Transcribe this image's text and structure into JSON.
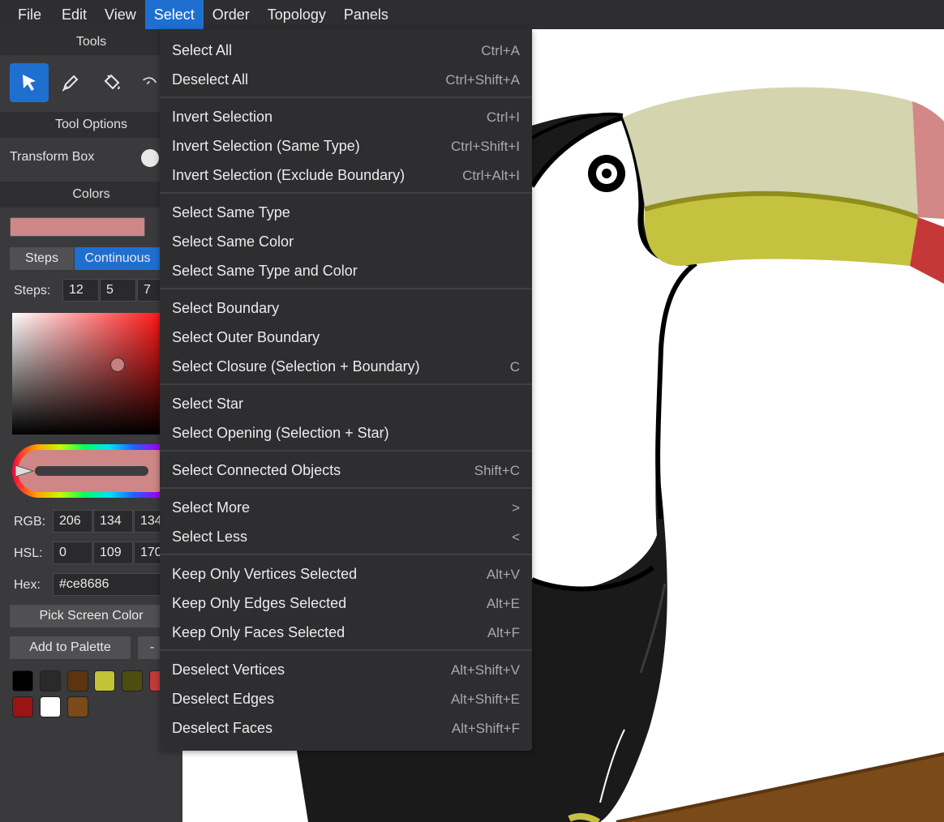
{
  "menubar": {
    "items": [
      "File",
      "Edit",
      "View",
      "Select",
      "Order",
      "Topology",
      "Panels"
    ],
    "active": "Select"
  },
  "panel": {
    "tools_header": "Tools",
    "tool_options_header": "Tool Options",
    "transform_box_label": "Transform Box",
    "colors_header": "Colors",
    "current_color": "#ce8686",
    "mode_steps": "Steps",
    "mode_continuous": "Continuous",
    "steps_label": "Steps:",
    "steps_values": [
      "12",
      "5",
      "7"
    ],
    "rgb_label": "RGB:",
    "rgb_values": [
      "206",
      "134",
      "134"
    ],
    "hsl_label": "HSL:",
    "hsl_values": [
      "0",
      "109",
      "170"
    ],
    "hex_label": "Hex:",
    "hex_value": "#ce8686",
    "pick_screen_color": "Pick Screen Color",
    "add_to_palette": "Add to Palette",
    "remove_from_palette": "-",
    "palette": [
      "#000000",
      "#2a2a2a",
      "#5a3510",
      "#c4c237",
      "#4d4d12",
      "#c43a3a",
      "#9a1414",
      "#ffffff",
      "#7a4a18"
    ],
    "accent_color": "#1f6fd1"
  },
  "select_menu": {
    "groups": [
      [
        {
          "label": "Select All",
          "shortcut": "Ctrl+A"
        },
        {
          "label": "Deselect All",
          "shortcut": "Ctrl+Shift+A"
        }
      ],
      [
        {
          "label": "Invert Selection",
          "shortcut": "Ctrl+I"
        },
        {
          "label": "Invert Selection (Same Type)",
          "shortcut": "Ctrl+Shift+I"
        },
        {
          "label": "Invert Selection (Exclude Boundary)",
          "shortcut": "Ctrl+Alt+I"
        }
      ],
      [
        {
          "label": "Select Same Type",
          "shortcut": ""
        },
        {
          "label": "Select Same Color",
          "shortcut": ""
        },
        {
          "label": "Select Same Type and Color",
          "shortcut": ""
        }
      ],
      [
        {
          "label": "Select Boundary",
          "shortcut": ""
        },
        {
          "label": "Select Outer Boundary",
          "shortcut": ""
        },
        {
          "label": "Select Closure (Selection + Boundary)",
          "shortcut": "C"
        }
      ],
      [
        {
          "label": "Select Star",
          "shortcut": ""
        },
        {
          "label": "Select Opening (Selection + Star)",
          "shortcut": ""
        }
      ],
      [
        {
          "label": "Select Connected Objects",
          "shortcut": "Shift+C"
        }
      ],
      [
        {
          "label": "Select More",
          "shortcut": ">"
        },
        {
          "label": "Select Less",
          "shortcut": "<"
        }
      ],
      [
        {
          "label": "Keep Only Vertices Selected",
          "shortcut": "Alt+V"
        },
        {
          "label": "Keep Only Edges Selected",
          "shortcut": "Alt+E"
        },
        {
          "label": "Keep Only Faces Selected",
          "shortcut": "Alt+F"
        }
      ],
      [
        {
          "label": "Deselect Vertices",
          "shortcut": "Alt+Shift+V"
        },
        {
          "label": "Deselect Edges",
          "shortcut": "Alt+Shift+E"
        },
        {
          "label": "Deselect Faces",
          "shortcut": "Alt+Shift+F"
        }
      ]
    ]
  }
}
